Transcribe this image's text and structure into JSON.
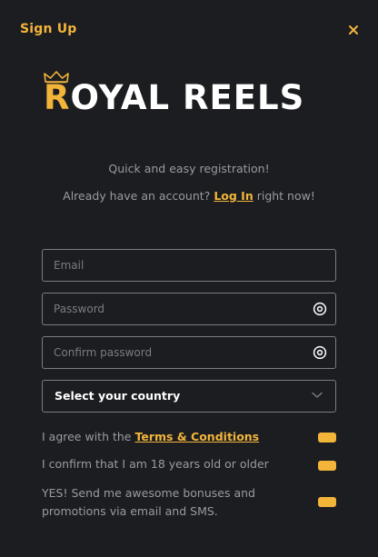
{
  "header": {
    "title": "Sign Up",
    "close_icon": "close-icon"
  },
  "logo": {
    "first_letter": "R",
    "rest": "OYAL REELS",
    "crown_icon": "crown-icon"
  },
  "intro": {
    "subtitle": "Quick and easy registration!",
    "login_prefix": "Already have an account?",
    "login_link": "Log In",
    "login_suffix": "right now!"
  },
  "form": {
    "email_placeholder": "Email",
    "password_placeholder": "Password",
    "confirm_placeholder": "Confirm password",
    "country_label": "Select your country"
  },
  "consents": [
    {
      "prefix": "I agree with the",
      "link": "Terms & Conditions",
      "checked": true
    },
    {
      "text": "I confirm that I am 18 years old or older",
      "checked": true
    },
    {
      "text": "YES! Send me awesome bonuses and promotions via email and SMS.",
      "checked": true
    }
  ],
  "colors": {
    "accent": "#f2b53a",
    "background": "#1c1d21",
    "muted_text": "#9a9ba0",
    "border": "#7c7d82"
  }
}
